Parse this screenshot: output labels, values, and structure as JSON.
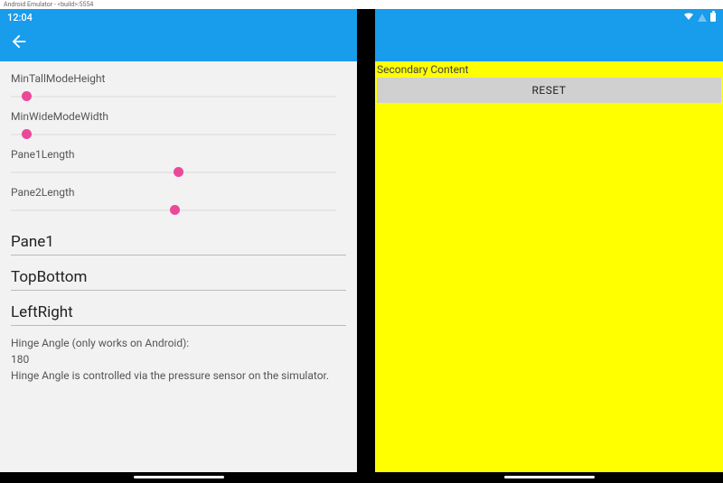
{
  "emulator": {
    "title": "Android Emulator - <build>:5554"
  },
  "status": {
    "time": "12:04"
  },
  "left": {
    "sliders": {
      "minTallModeHeight": {
        "label": "MinTallModeHeight",
        "pos": 12
      },
      "minWideModeWidth": {
        "label": "MinWideModeWidth",
        "pos": 12
      },
      "pane1Length": {
        "label": "Pane1Length",
        "pos": 180
      },
      "pane2Length": {
        "label": "Pane2Length",
        "pos": 176
      }
    },
    "items": {
      "pane1": "Pane1",
      "topBottom": "TopBottom",
      "leftRight": "LeftRight"
    },
    "hinge": {
      "label": "Hinge Angle (only works on Android):",
      "value": "180",
      "note": "Hinge Angle is controlled via the pressure sensor on the simulator."
    }
  },
  "right": {
    "secondary_label": "Secondary Content",
    "reset_label": "RESET"
  }
}
